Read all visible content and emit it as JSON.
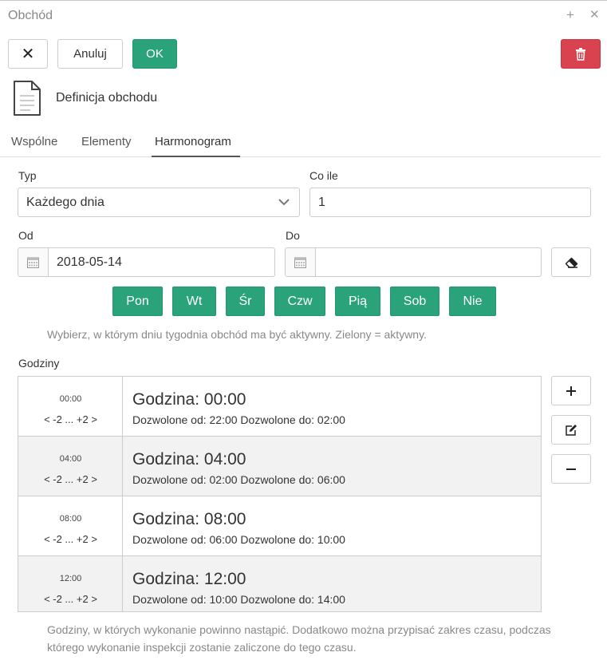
{
  "window": {
    "title": "Obchód",
    "add_glyph": "+",
    "close_glyph": "✕"
  },
  "toolbar": {
    "close_glyph": "✕",
    "cancel_label": "Anuluj",
    "ok_label": "OK",
    "ok_color": "#2aa27a",
    "delete_color": "#d9434f"
  },
  "header": {
    "title": "Definicja obchodu",
    "icon": "document-icon"
  },
  "tabs": [
    {
      "label": "Wspólne",
      "active": false
    },
    {
      "label": "Elementy",
      "active": false
    },
    {
      "label": "Harmonogram",
      "active": true
    }
  ],
  "form": {
    "typ": {
      "label": "Typ",
      "value": "Każdego dnia"
    },
    "co_ile": {
      "label": "Co ile",
      "value": "1"
    },
    "od": {
      "label": "Od",
      "value": "2018-05-14"
    },
    "do": {
      "label": "Do",
      "value": ""
    }
  },
  "days": [
    {
      "label": "Pon",
      "active": true
    },
    {
      "label": "Wt",
      "active": true
    },
    {
      "label": "Śr",
      "active": true
    },
    {
      "label": "Czw",
      "active": true
    },
    {
      "label": "Pią",
      "active": true
    },
    {
      "label": "Sob",
      "active": true
    },
    {
      "label": "Nie",
      "active": true
    }
  ],
  "days_hint": "Wybierz, w którym dniu tygodnia obchód ma być aktywny. Zielony = aktywny.",
  "hours": {
    "label": "Godziny",
    "rows": [
      {
        "time": "00:00",
        "range": "< -2 ... +2 >",
        "title": "Godzina: 00:00",
        "desc": "Dozwolone od: 22:00 Dozwolone do: 02:00"
      },
      {
        "time": "04:00",
        "range": "< -2 ... +2 >",
        "title": "Godzina: 04:00",
        "desc": "Dozwolone od: 02:00 Dozwolone do: 06:00"
      },
      {
        "time": "08:00",
        "range": "< -2 ... +2 >",
        "title": "Godzina: 08:00",
        "desc": "Dozwolone od: 06:00 Dozwolone do: 10:00"
      },
      {
        "time": "12:00",
        "range": "< -2 ... +2 >",
        "title": "Godzina: 12:00",
        "desc": "Dozwolone od: 10:00 Dozwolone do: 14:00"
      }
    ],
    "hint": "Godziny, w których wykonanie powinno nastąpić. Dodatkowo można przypisać zakres czasu, podczas którego wykonanie inspekcji zostanie zaliczone do tego czasu."
  }
}
